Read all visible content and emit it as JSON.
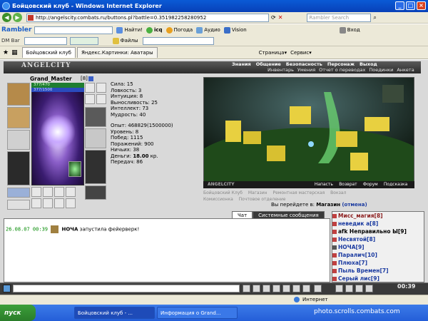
{
  "window": {
    "title": "Бойцовский клуб - Windows Internet Explorer"
  },
  "address": {
    "url": "http://angelscity.combats.ru/buttons.pl?battle=0.351982258280952",
    "search_placeholder": "Rambler Search"
  },
  "toolbar": {
    "logo": "Rambler",
    "find_label": "Найти!",
    "icq_label": "icq",
    "weather_label": "Погода",
    "audio_label": "Аудио",
    "vision_label": "Vision",
    "login_label": "Вход",
    "dm_bar_label": "DM Bar",
    "files_label": "Файлы"
  },
  "tabs": [
    {
      "label": "Бойцовский клуб"
    },
    {
      "label": "Яндекс.Картинки: Аватары"
    }
  ],
  "ie_commands": {
    "page_label": "Страница",
    "service_label": "Сервис"
  },
  "game": {
    "logo": "ANGELCITY",
    "main_menu": [
      "Знания",
      "Общение",
      "Безопасность",
      "Персонаж",
      "Выход"
    ],
    "sub_menu": [
      "Инвентарь",
      "Умения",
      "Отчет о переводах",
      "Поединки",
      "Анкета"
    ],
    "character": {
      "name": "Grand_Master",
      "level": "[8]",
      "hp": "377/470",
      "mp": "377/1500"
    },
    "stats": [
      "Сила: 15",
      "Ловкость: 3",
      "Интуиция: 8",
      "Выносливость: 25",
      "Интеллект: 73",
      "Мудрость: 40"
    ],
    "progress": [
      "Опыт: 468829(1500000)",
      "Уровень: 8",
      "Побед: 1115",
      "Поражений: 900",
      "Ничьих: 38"
    ],
    "money_label": "Деньги:",
    "money_value": "18.00",
    "money_unit": "кр.",
    "transfers": "Передач: 86",
    "scene_logo": "ANGELCITY",
    "scene_actions": [
      "Напасть",
      "Возврат",
      "Форум",
      "Подсказка"
    ],
    "city_links": [
      "Бойцовский Клуб",
      "Магазин",
      "Ремонтная мастерская",
      "Вокзал",
      "Комиссионка",
      "Почтовое отделение"
    ],
    "location_prefix": "Вы перейдете в:",
    "location_target": "Магазин",
    "location_cancel": "(отмена)"
  },
  "chat": {
    "tabs": [
      "Чат",
      "Системные сообщения"
    ],
    "message": {
      "time": "26.08.07 00:39",
      "user": "НОЧА",
      "text": "запустила фейерверк!"
    }
  },
  "users": [
    "Мисс_магия[8]",
    "неведик а[8]",
    "afk Неправильно Ы[9]",
    "Несвятой[8]",
    "НОЧА[9]",
    "Паралич[10]",
    "Плюха[7]",
    "Пыль Времен[7]",
    "Серый лис[9]"
  ],
  "clock": "00:39",
  "status": {
    "internet_label": "Интернет"
  },
  "taskbar": {
    "start_label": "пуск",
    "tasks": [
      "Бойцовский клуб - ...",
      "Информация о Grand..."
    ]
  },
  "watermark": "photo.scrolls.combats.com",
  "colors": {
    "title_bar": "#0a5bd6",
    "game_header": "#2b2b2b",
    "user_name": "#1a3aa0",
    "chat_time": "#008a00",
    "hp": "#1e7d30",
    "mp": "#2a4bbd"
  }
}
